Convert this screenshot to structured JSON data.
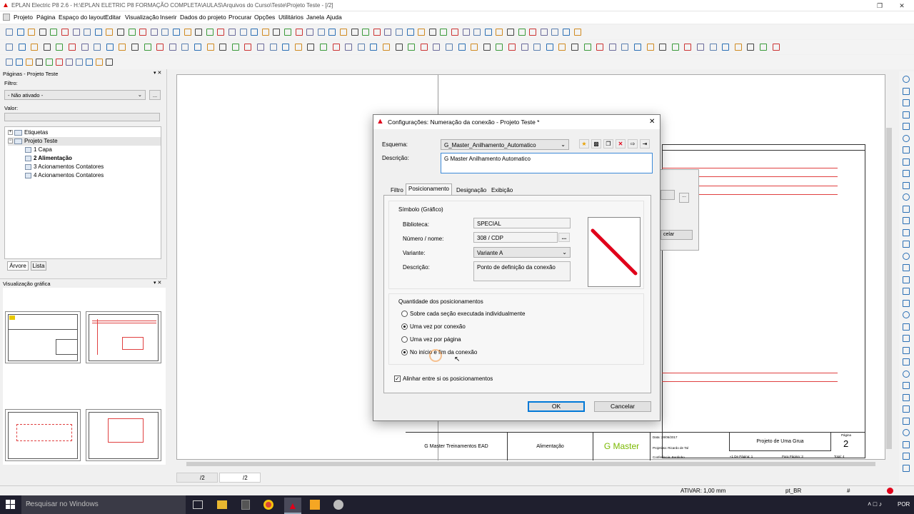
{
  "window": {
    "title": "EPLAN Electric P8 2.6 - H:\\EPLAN ELETRIC P8 FORMAÇÃO COMPLETA\\AULAS\\Arquivos do Curso\\Teste\\Projeto Teste - [/2]"
  },
  "menu": [
    "Projeto",
    "Página",
    "Espaço do layout",
    "Editar",
    "Visualização",
    "Inserir",
    "Dados do projeto",
    "Procurar",
    "Opções",
    "Utilitários",
    "Janela",
    "Ajuda"
  ],
  "pages_panel": {
    "title": "Páginas - Projeto Teste",
    "filter_label": "Filtro:",
    "filter_value": "- Não ativado -",
    "filter_btn": "...",
    "value_label": "Valor:",
    "tree": [
      {
        "label": "Etiquetas",
        "level": 0,
        "bold": false
      },
      {
        "label": "Projeto Teste",
        "level": 0,
        "bold": false
      },
      {
        "label": "1 Capa",
        "level": 1,
        "bold": false
      },
      {
        "label": "2 Alimentação",
        "level": 1,
        "bold": true
      },
      {
        "label": "3 Acionamentos Contatores",
        "level": 1,
        "bold": false
      },
      {
        "label": "4 Acionamentos Contatores",
        "level": 1,
        "bold": false
      }
    ],
    "tab_tree": "Árvore",
    "tab_list": "Lista"
  },
  "graphic_panel": {
    "title": "Visualização gráfica"
  },
  "page_tabs": [
    "/2",
    "/2"
  ],
  "titleblock": {
    "company": "G Master Treinamentos EAD",
    "page_desc": "Alimentação",
    "logo": "G Master",
    "date": "Data: 28/06/2017",
    "editor": "Projetista: Ricardo de Tal",
    "checked": "Conferência: Bordinho",
    "project": "Projeto de Uma Grua",
    "page_label": "Página",
    "page_num": "2",
    "prev": "«1 De Página: 1",
    "next": "Para Página: 3",
    "total": "Total: 4"
  },
  "dialog": {
    "title": "Configurações: Numeração da conexão - Projeto Teste *",
    "scheme_label": "Esquema:",
    "scheme_value": "G_Master_Anilhamento_Automatico",
    "desc_label": "Descrição:",
    "desc_value": "G Master Anilhamento Automatico",
    "tabs": [
      "Filtro",
      "Posicionamento",
      "Designação",
      "Exibição"
    ],
    "symbol_group": "Símbolo (Gráfico)",
    "library_label": "Biblioteca:",
    "library_value": "SPECIAL",
    "number_label": "Número / nome:",
    "number_value": "308 / CDP",
    "number_btn": "...",
    "variant_label": "Variante:",
    "variant_value": "Variante A",
    "sdesc_label": "Descrição:",
    "sdesc_value": "Ponto de definição da conexão",
    "qty_group": "Quantidade dos posicionamentos",
    "options": [
      {
        "label": "Sobre cada seção executada individualmente",
        "selected": false
      },
      {
        "label": "Uma vez por conexão",
        "selected": true
      },
      {
        "label": "Uma vez por página",
        "selected": false
      },
      {
        "label": "No início e fim da conexão",
        "selected": true
      }
    ],
    "align_label": "Alinhar entre si os posicionamentos",
    "align_checked": "✓",
    "ok": "OK",
    "cancel": "Cancelar"
  },
  "bg_dialog": {
    "cancel_partial": "celar",
    "btn": "..."
  },
  "status": {
    "snap": "ATIVAR: 1,00 mm",
    "lang": "pt_BR",
    "hash": "#"
  },
  "taskbar": {
    "search": "Pesquisar no Windows",
    "lang": "POR"
  },
  "colors": {
    "accent": "#0078d7",
    "red": "#e0001a",
    "wire": "#e04040",
    "taskbar": "#1f1f2e"
  }
}
